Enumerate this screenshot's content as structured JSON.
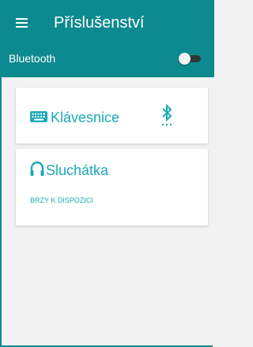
{
  "header": {
    "title": "Příslušenství"
  },
  "bluetooth": {
    "label": "Bluetooth",
    "enabled": false
  },
  "devices": [
    {
      "label": "Klávesnice",
      "icon": "keyboard-icon",
      "status_icon": "bluetooth-searching-icon"
    },
    {
      "label": "Sluchátka",
      "icon": "headphones-icon",
      "note": "BRZY K DISPOZICI"
    }
  ],
  "colors": {
    "primary": "#0d8a8f",
    "accent": "#1aaab8",
    "background": "#f2f2f2",
    "card": "#ffffff"
  }
}
